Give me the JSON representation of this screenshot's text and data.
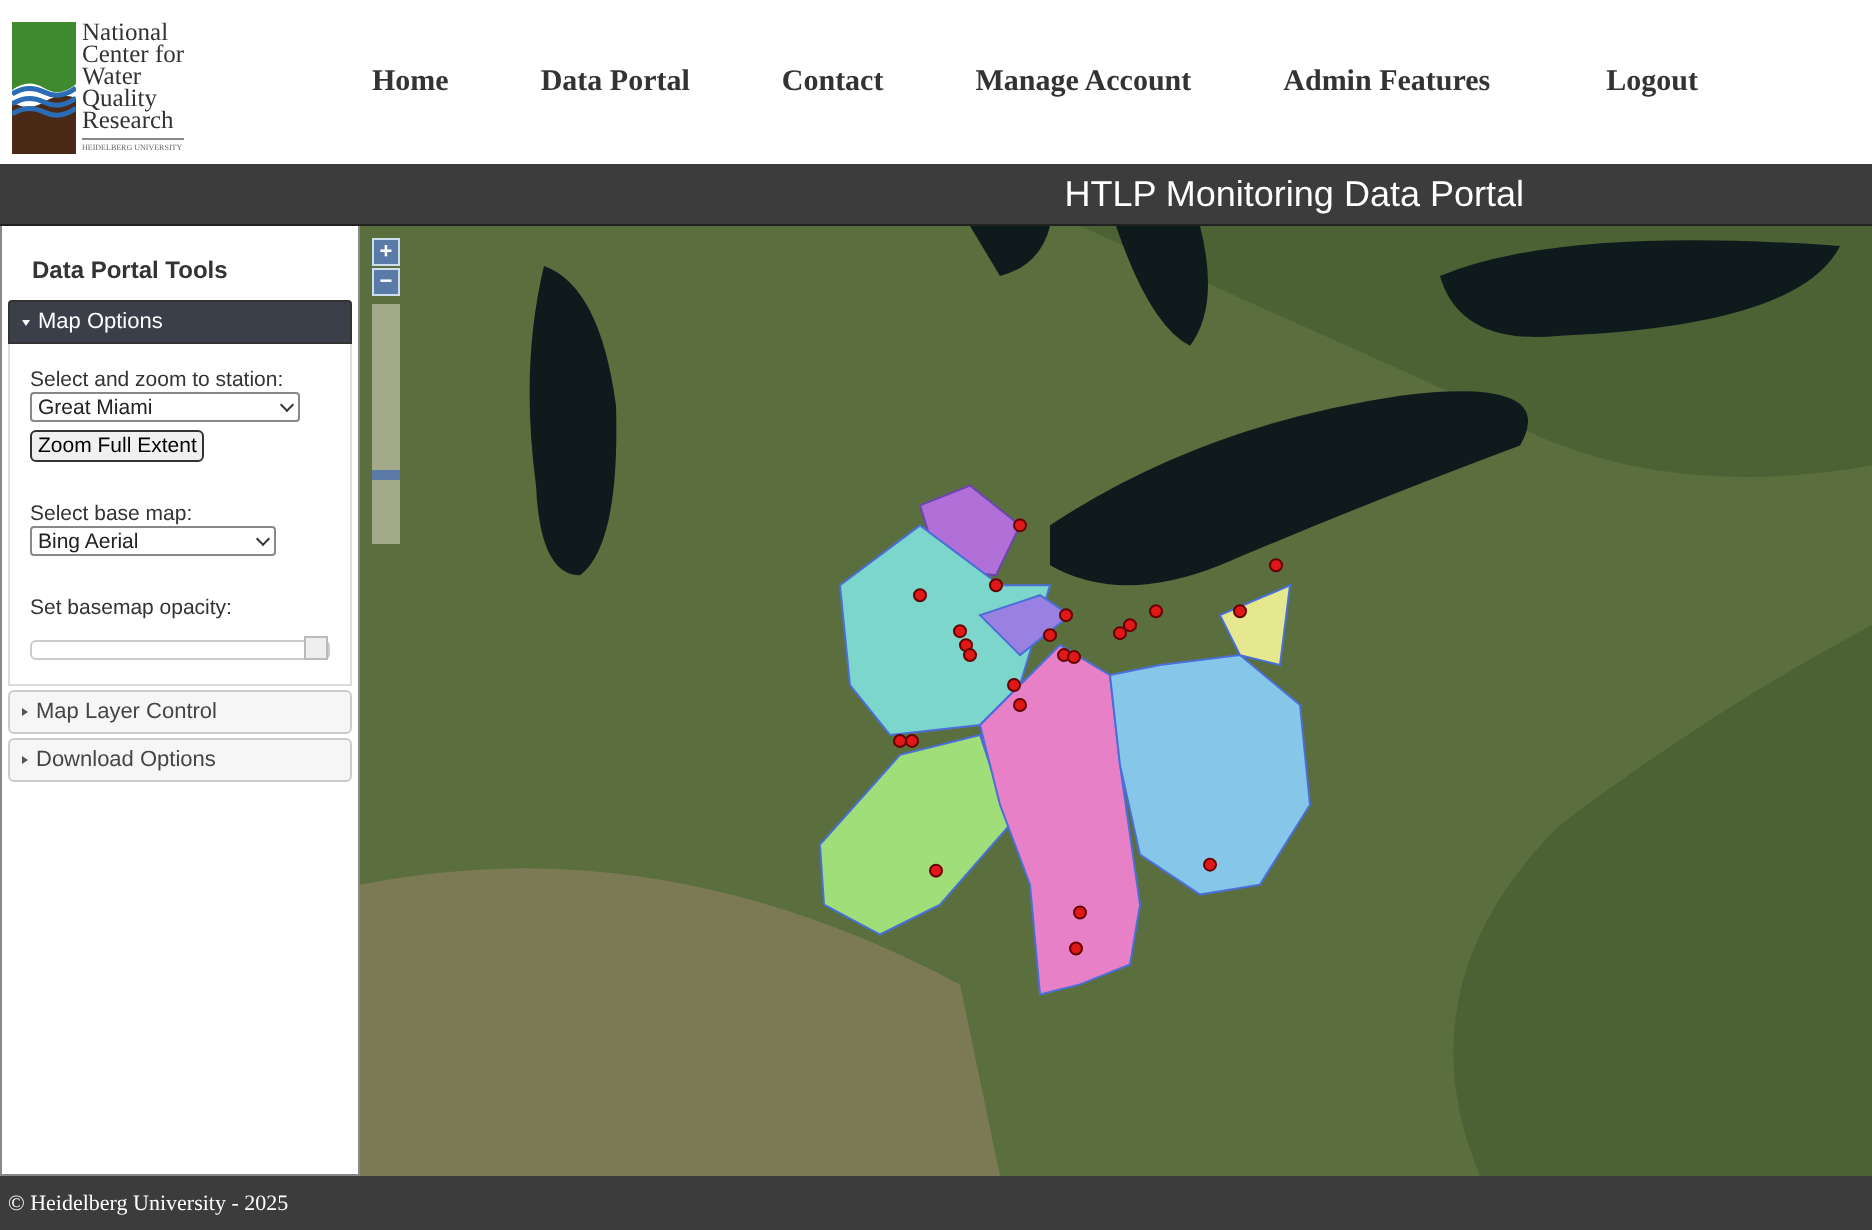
{
  "logo": {
    "lines": [
      "National",
      "Center for",
      "Water",
      "Quality",
      "Research"
    ],
    "subtitle": "HEIDELBERG UNIVERSITY"
  },
  "nav": [
    "Home",
    "Data Portal",
    "Contact",
    "Manage Account",
    "Admin Features",
    "Logout"
  ],
  "title_bar": {
    "title": "HTLP Monitoring Data Portal"
  },
  "sidebar": {
    "title": "Data Portal Tools",
    "panels": [
      {
        "label": "Map Options",
        "expanded": true,
        "controls": [
          {
            "kind": "select",
            "label": "Select and zoom to station:",
            "value": "Great Miami"
          },
          {
            "kind": "button",
            "label": "Zoom Full Extent"
          },
          {
            "kind": "select",
            "label": "Select base map:",
            "value": "Bing Aerial"
          },
          {
            "kind": "slider",
            "label": "Set basemap opacity:",
            "level": 1
          }
        ]
      },
      {
        "label": "Map Layer Control",
        "expanded": false
      },
      {
        "label": "Download Options",
        "expanded": false
      }
    ]
  },
  "map": {
    "zoom_in": "+",
    "zoom_out": "−",
    "level": 0.27
  },
  "footer": "© Heidelberg University - 2025"
}
